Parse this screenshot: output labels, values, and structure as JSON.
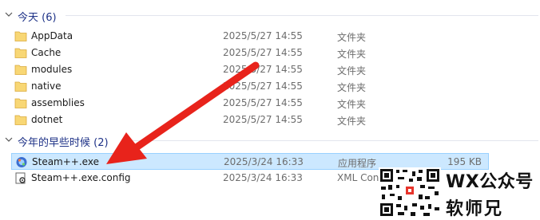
{
  "groups": [
    {
      "title": "今天 (6)"
    },
    {
      "title": "今年的早些时候 (2)"
    }
  ],
  "today_items": [
    {
      "name": "AppData",
      "date": "2025/5/27 14:55",
      "type": "文件夹",
      "size": "",
      "icon": "folder-icon"
    },
    {
      "name": "Cache",
      "date": "2025/5/27 14:55",
      "type": "文件夹",
      "size": "",
      "icon": "folder-icon"
    },
    {
      "name": "modules",
      "date": "2025/5/27 14:55",
      "type": "文件夹",
      "size": "",
      "icon": "folder-icon"
    },
    {
      "name": "native",
      "date": "2025/5/27 14:55",
      "type": "文件夹",
      "size": "",
      "icon": "folder-icon"
    },
    {
      "name": "assemblies",
      "date": "2025/5/27 14:55",
      "type": "文件夹",
      "size": "",
      "icon": "folder-icon"
    },
    {
      "name": "dotnet",
      "date": "2025/5/27 14:55",
      "type": "文件夹",
      "size": "",
      "icon": "folder-icon"
    }
  ],
  "earlier_items": [
    {
      "name": "Steam++.exe",
      "date": "2025/3/24 16:33",
      "type": "应用程序",
      "size": "195 KB",
      "icon": "steam-app-icon",
      "selected": true
    },
    {
      "name": "Steam++.exe.config",
      "date": "2025/3/24 16:33",
      "type": "XML Con",
      "size": "",
      "icon": "config-file-icon"
    }
  ],
  "watermark": {
    "line1": "WX公众号",
    "line2": "软师兄"
  },
  "colors": {
    "accent": "#1e3287",
    "folder": "#f8d775",
    "selected_bg": "#cce8ff",
    "arrow": "#e8231b"
  }
}
